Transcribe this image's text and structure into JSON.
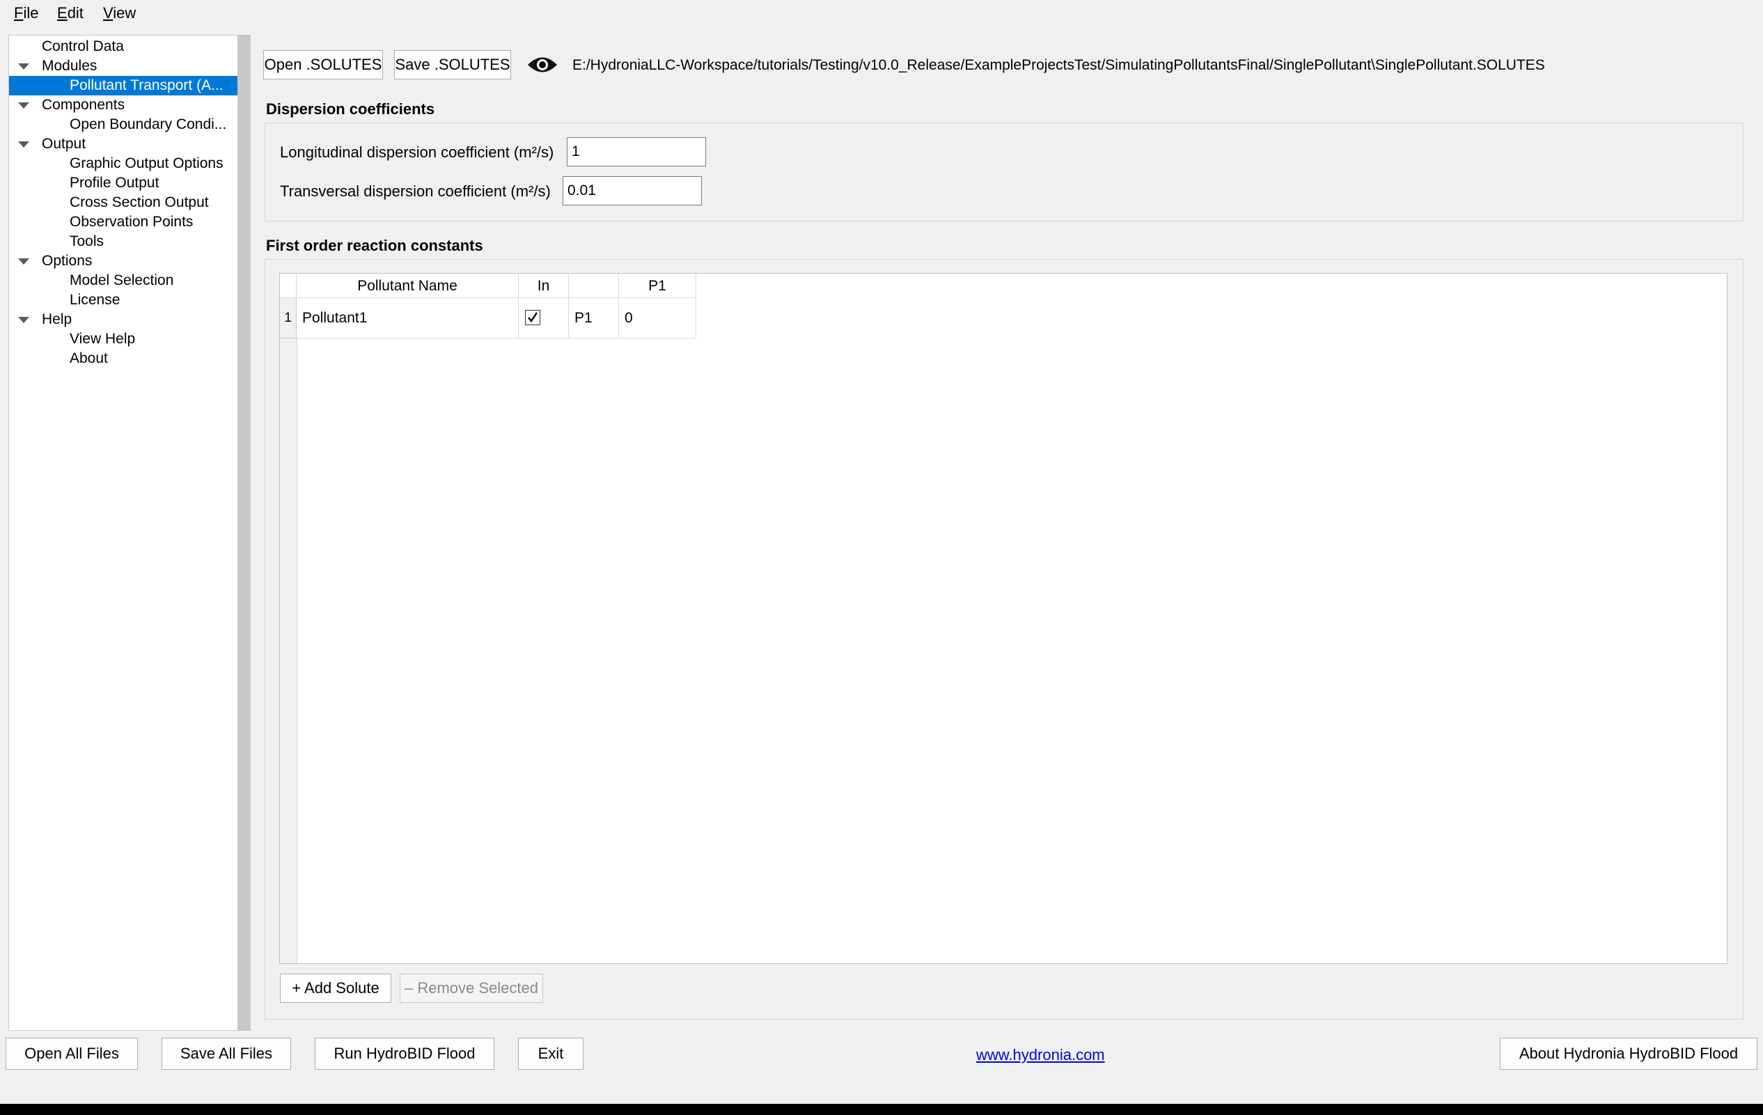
{
  "menu": [
    "File",
    "Edit",
    "View"
  ],
  "tree": [
    {
      "label": "Control Data",
      "level": 0,
      "expandable": false,
      "selected": false
    },
    {
      "label": "Modules",
      "level": 0,
      "expandable": true,
      "selected": false
    },
    {
      "label": "Pollutant Transport (A...",
      "level": 1,
      "expandable": false,
      "selected": true
    },
    {
      "label": "Components",
      "level": 0,
      "expandable": true,
      "selected": false
    },
    {
      "label": "Open Boundary Condi...",
      "level": 1,
      "expandable": false,
      "selected": false
    },
    {
      "label": "Output",
      "level": 0,
      "expandable": true,
      "selected": false
    },
    {
      "label": "Graphic Output Options",
      "level": 1,
      "expandable": false,
      "selected": false
    },
    {
      "label": "Profile Output",
      "level": 1,
      "expandable": false,
      "selected": false
    },
    {
      "label": "Cross Section Output",
      "level": 1,
      "expandable": false,
      "selected": false
    },
    {
      "label": "Observation Points",
      "level": 1,
      "expandable": false,
      "selected": false
    },
    {
      "label": "Tools",
      "level": 1,
      "expandable": false,
      "selected": false
    },
    {
      "label": "Options",
      "level": 0,
      "expandable": true,
      "selected": false
    },
    {
      "label": "Model Selection",
      "level": 1,
      "expandable": false,
      "selected": false
    },
    {
      "label": "License",
      "level": 1,
      "expandable": false,
      "selected": false
    },
    {
      "label": "Help",
      "level": 0,
      "expandable": true,
      "selected": false
    },
    {
      "label": "View Help",
      "level": 1,
      "expandable": false,
      "selected": false
    },
    {
      "label": "About",
      "level": 1,
      "expandable": false,
      "selected": false
    }
  ],
  "toolbar": {
    "open_label": "Open .SOLUTES",
    "save_label": "Save .SOLUTES",
    "file_path": "E:/HydroniaLLC-Workspace/tutorials/Testing/v10.0_Release/ExampleProjectsTest/SimulatingPollutantsFinal/SinglePollutant\\SinglePollutant.SOLUTES"
  },
  "dispersion": {
    "title": "Dispersion coefficients",
    "longitudinal_label": "Longitudinal dispersion coefficient (m²/s)",
    "longitudinal_value": "1",
    "transversal_label": "Transversal dispersion coefficient (m²/s)",
    "transversal_value": "0.01"
  },
  "reactions": {
    "title": "First order reaction constants",
    "columns": [
      "Pollutant Name",
      "In",
      "",
      "P1"
    ],
    "rows": [
      {
        "num": "1",
        "name": "Pollutant1",
        "in": true,
        "tag": "P1",
        "p1": "0"
      }
    ],
    "add_label": "+ Add Solute",
    "remove_label": "– Remove Selected"
  },
  "footer": {
    "open_all": "Open All Files",
    "save_all": "Save All Files",
    "run": "Run HydroBID Flood",
    "exit": "Exit",
    "link": "www.hydronia.com",
    "about": "About Hydronia HydroBID Flood"
  }
}
